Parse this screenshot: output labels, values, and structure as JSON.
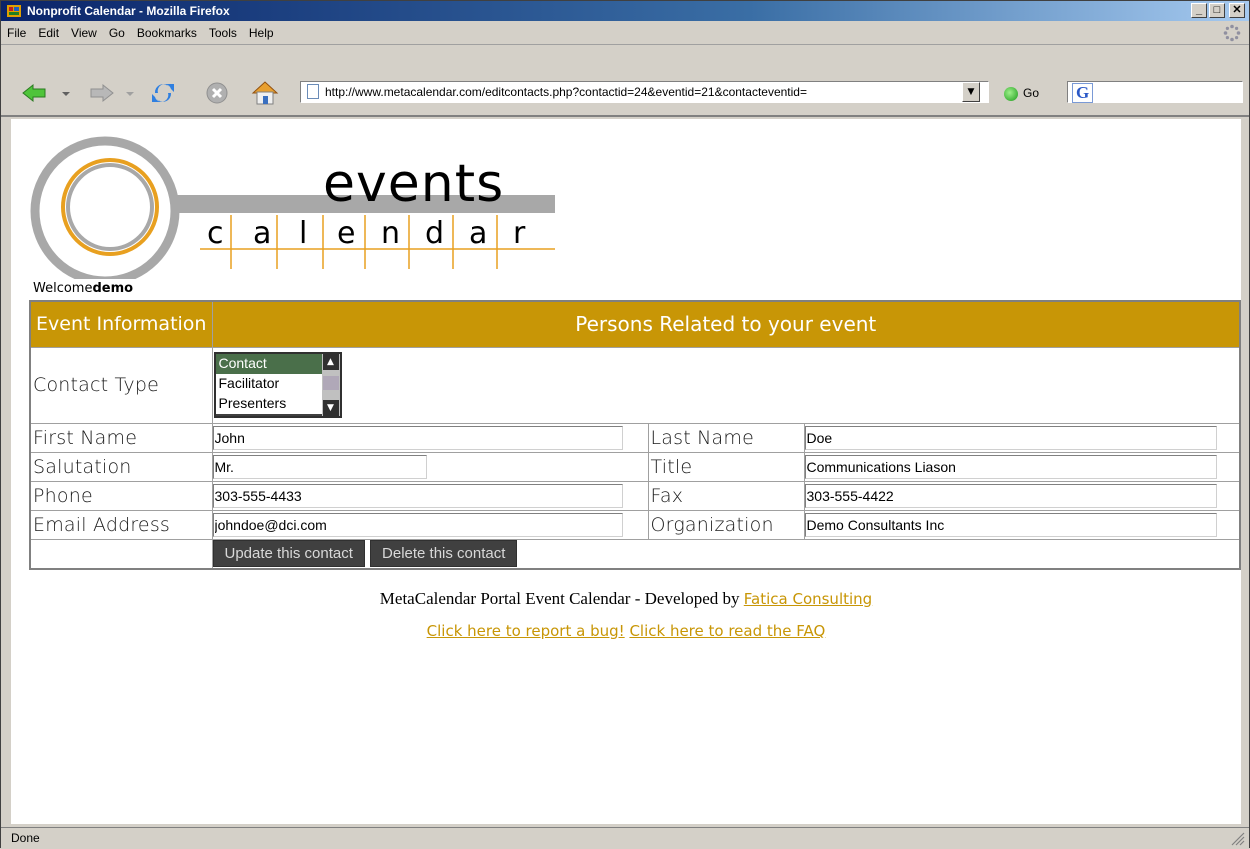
{
  "window": {
    "title": "Nonprofit Calendar - Mozilla Firefox",
    "min_glyph": "_",
    "max_glyph": "□",
    "close_glyph": "✕"
  },
  "menu": {
    "items": [
      "File",
      "Edit",
      "View",
      "Go",
      "Bookmarks",
      "Tools",
      "Help"
    ]
  },
  "nav": {
    "back_icon": "back-arrow-icon",
    "forward_icon": "forward-arrow-icon",
    "reload_icon": "reload-icon",
    "stop_icon": "stop-icon",
    "home_icon": "home-icon",
    "url": "http://www.metacalendar.com/editcontacts.php?contactid=24&eventid=21&contacteventid=",
    "go_label": "Go",
    "search_glyph": "G"
  },
  "logo": {
    "word_top": "events",
    "letters": [
      "c",
      "a",
      "l",
      "e",
      "n",
      "d",
      "a",
      "r"
    ],
    "welcome_prefix": "Welcome",
    "welcome_user": "demo"
  },
  "form": {
    "header_left": "Event Information",
    "header_right": "Persons Related to your event",
    "contact_type_label": "Contact Type",
    "contact_type_options": [
      "Contact",
      "Facilitator",
      "Presenters"
    ],
    "contact_type_selected": "Contact",
    "first_name_label": "First Name",
    "first_name_value": "John",
    "last_name_label": "Last Name",
    "last_name_value": "Doe",
    "salutation_label": "Salutation",
    "salutation_value": "Mr.",
    "title_label": "Title",
    "title_value": "Communications Liason",
    "phone_label": "Phone",
    "phone_value": "303-555-4433",
    "fax_label": "Fax",
    "fax_value": "303-555-4422",
    "email_label": "Email Address",
    "email_value": "johndoe@dci.com",
    "org_label": "Organization",
    "org_value": "Demo Consultants Inc",
    "update_button": "Update this contact",
    "delete_button": "Delete this contact"
  },
  "footer": {
    "text": "MetaCalendar Portal Event Calendar - Developed by ",
    "dev_link": "Fatica Consulting",
    "bug_link": "Click here to report a bug!",
    "faq_link": "Click here to read the FAQ"
  },
  "status": {
    "text": "Done"
  },
  "colors": {
    "accent_gold": "#c89606",
    "button_dark": "#404040",
    "titlebar_blue": "#0a246a"
  }
}
